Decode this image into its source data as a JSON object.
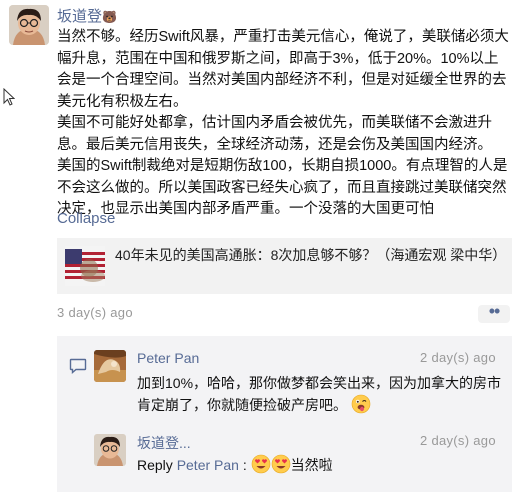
{
  "post": {
    "author": "坂道登",
    "author_emoji": "🐻",
    "paragraphs": [
      "当然不够。经历Swift风暴，严重打击美元信心，俺说了，美联储必须大幅升息，范围在中国和俄罗斯之间，即高于3%，低于20%。10%以上会是一个合理空间。当然对美国内部经济不利，但是对延缓全世界的去美元化有积极左右。",
      "美国不可能好处都拿，估计国内矛盾会被优先，而美联储不会激进升息。最后美元信用丧失，全球经济动荡，还是会伤及美国国内经济。",
      "美国的Swift制裁绝对是短期伤敌100，长期自损1000。有点理智的人是不会这么做的。所以美国政客已经失心疯了，而且直接跳过美联储突然决定，也显示出美国内部矛盾严重。一个没落的大国更可怕"
    ],
    "collapse_label": "Collapse",
    "shared_article_title": "40年未见的美国高通胀：8次加息够不够？（海通宏观 梁中华）",
    "time": "3 day(s) ago",
    "more_label": "••"
  },
  "comments": [
    {
      "author": "Peter Pan",
      "time": "2 day(s) ago",
      "text": "加到10%，哈哈，那你做梦都会笑出来，因为加拿大的房市肯定崩了，你就随便捡破产房吧。"
    },
    {
      "author": "坂道登...",
      "time": "2 day(s) ago",
      "reply_prefix": "Reply",
      "reply_to": "Peter Pan",
      "separator": ":",
      "text": "当然啦"
    }
  ],
  "icons": {
    "comment": "comment-bubble-icon",
    "cursor": "mouse-pointer-icon",
    "emoji_tongue": "tongue-wink-emoji",
    "emoji_heart_eyes": "heart-eyes-emoji"
  },
  "colors": {
    "link": "#576b95",
    "meta": "#999999",
    "comment_bg": "#f3f3f5",
    "card_bg": "#f2f2f2"
  }
}
